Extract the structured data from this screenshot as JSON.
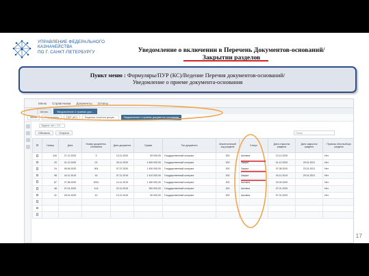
{
  "org": {
    "lines": [
      "УПРАВЛЕНИЕ ФЕДЕРАЛЬНОГО",
      "КАЗНАЧЕЙСТВА",
      "ПО Г. САНКТ-ПЕТЕРБУРГУ"
    ]
  },
  "title": {
    "line1": "Уведомление о включении в Перечень Документов-оснований/",
    "line2": "Закрытии разделов"
  },
  "menu": {
    "label": "Пункт меню :",
    "path1": " Формуляры/ПУР (КС)/Ведение Перечня документов-оснований/",
    "path2": "Уведомление о приеме документа-основания"
  },
  "app": {
    "menubar": [
      "Меню",
      "Справочники",
      "Документы",
      "Отчеты"
    ],
    "tabs": [
      {
        "label": "Меню",
        "active": false
      },
      {
        "label": "Уведомление о приеме док...",
        "active": true
      }
    ],
    "breadcrumbs": [
      {
        "label": "Меню",
        "active": false
      },
      {
        "label": "Формуляры",
        "active": false
      },
      {
        "label": "ПУР (КС)",
        "active": false
      },
      {
        "label": "Ведение перечня докум...",
        "active": false
      },
      {
        "label": "Уведомление о приеме документа-основания",
        "active": true
      }
    ],
    "filter_field": "Задачи: нет > Тл",
    "toolbar": {
      "refresh": "Обновить",
      "open": "Открыть",
      "search_placeholder": "Поиск"
    },
    "columns": [
      "",
      "Номер",
      "Дата",
      "Номер документа-основания",
      "Дата документа",
      "Сумма",
      "Тип документа",
      "Аналитический код раздела",
      "Статус",
      "Дата открытия раздела",
      "Дата закрытия раздела",
      "Признак сбоя выбора раздела"
    ],
    "rows": [
      [
        "",
        "434",
        "27.12.2020",
        "3",
        "13.11.2020",
        "59 000,00",
        "Государственный контракт",
        "200",
        "Активна",
        "13.12.2020",
        "",
        "Нет"
      ],
      [
        "",
        "20",
        "01.12.2020",
        "02",
        "30.11.2020",
        "1 600 000,00",
        "Государственный контракт",
        "200",
        "Закрыт",
        "01.12.2020",
        "29.01.2021",
        "Нет"
      ],
      [
        "",
        "24",
        "06.06.2020",
        "004",
        "07.07.2020",
        "1 490 000,00",
        "Государственный контракт",
        "200",
        "Закрыт",
        "07.08.2020",
        "23.01.2021",
        "Нет"
      ],
      [
        "",
        "08",
        "04.11.2019",
        "16",
        "07.11.2019",
        "1 410 000,00",
        "Государственный контракт",
        "200",
        "Закрыт",
        "04.11.2019",
        "29.01.2021",
        "Нет"
      ],
      [
        "",
        "87",
        "27.08.2020",
        "0001",
        "14.11.2019",
        "1 180 000,00",
        "Государственный контракт",
        "200",
        "Активна",
        "15.03.2020",
        "",
        "Нет"
      ],
      [
        "",
        "48",
        "07.01.2020",
        "1/11",
        "20.12.2019",
        "300 000,00",
        "Государственный контракт",
        "200",
        "Активна",
        "07.01.2020",
        "",
        "Нет"
      ],
      [
        "",
        "31",
        "09.01.2020",
        "10",
        "13.12.2019",
        "50 000,00",
        "Государственный контракт",
        "200",
        "Активна",
        "07.01.2020",
        "",
        "Нет"
      ],
      [
        "",
        "",
        "",
        "",
        "",
        "",
        "",
        "",
        "",
        "",
        "",
        ""
      ],
      [
        "",
        "",
        "",
        "",
        "",
        "",
        "",
        "",
        "",
        "",
        "",
        ""
      ],
      [
        "",
        "",
        "",
        "",
        "",
        "",
        "",
        "",
        "",
        "",
        "",
        ""
      ]
    ]
  },
  "page_number": "17",
  "colors": {
    "brand_blue": "#1a5aa6",
    "highlight_orange": "#f2a54a",
    "underline_red": "#d41f26",
    "box_border": "#2c4c86"
  }
}
